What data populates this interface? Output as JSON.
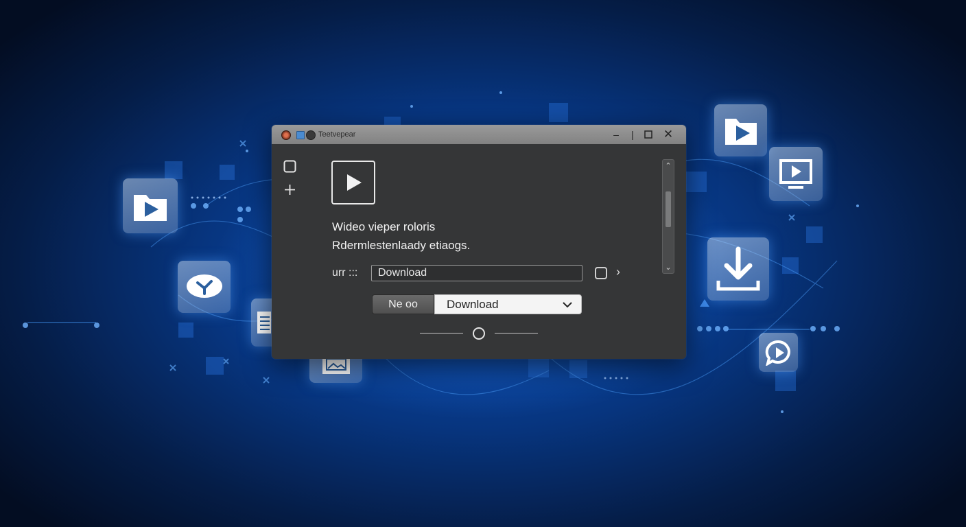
{
  "window": {
    "title": "Teetvepear",
    "heading": "Wideo vieper roloris",
    "subheading": "Rdermlestenlaady etiaogs.",
    "url_label": "urr :::",
    "url_value": "Download",
    "ne_button_label": "Ne oo",
    "download_select_value": "Download"
  },
  "icons": {
    "sidebar": [
      "square-icon",
      "plus-icon"
    ],
    "tiles": [
      "video-folder-icon",
      "chat-bubble-icon",
      "document-icon",
      "image-icon",
      "video-folder-icon",
      "monitor-play-icon",
      "download-icon",
      "chat-play-icon"
    ]
  },
  "colors": {
    "accent": "#1565d8",
    "window_bg": "#353637",
    "titlebar": "#8e8e8e"
  }
}
